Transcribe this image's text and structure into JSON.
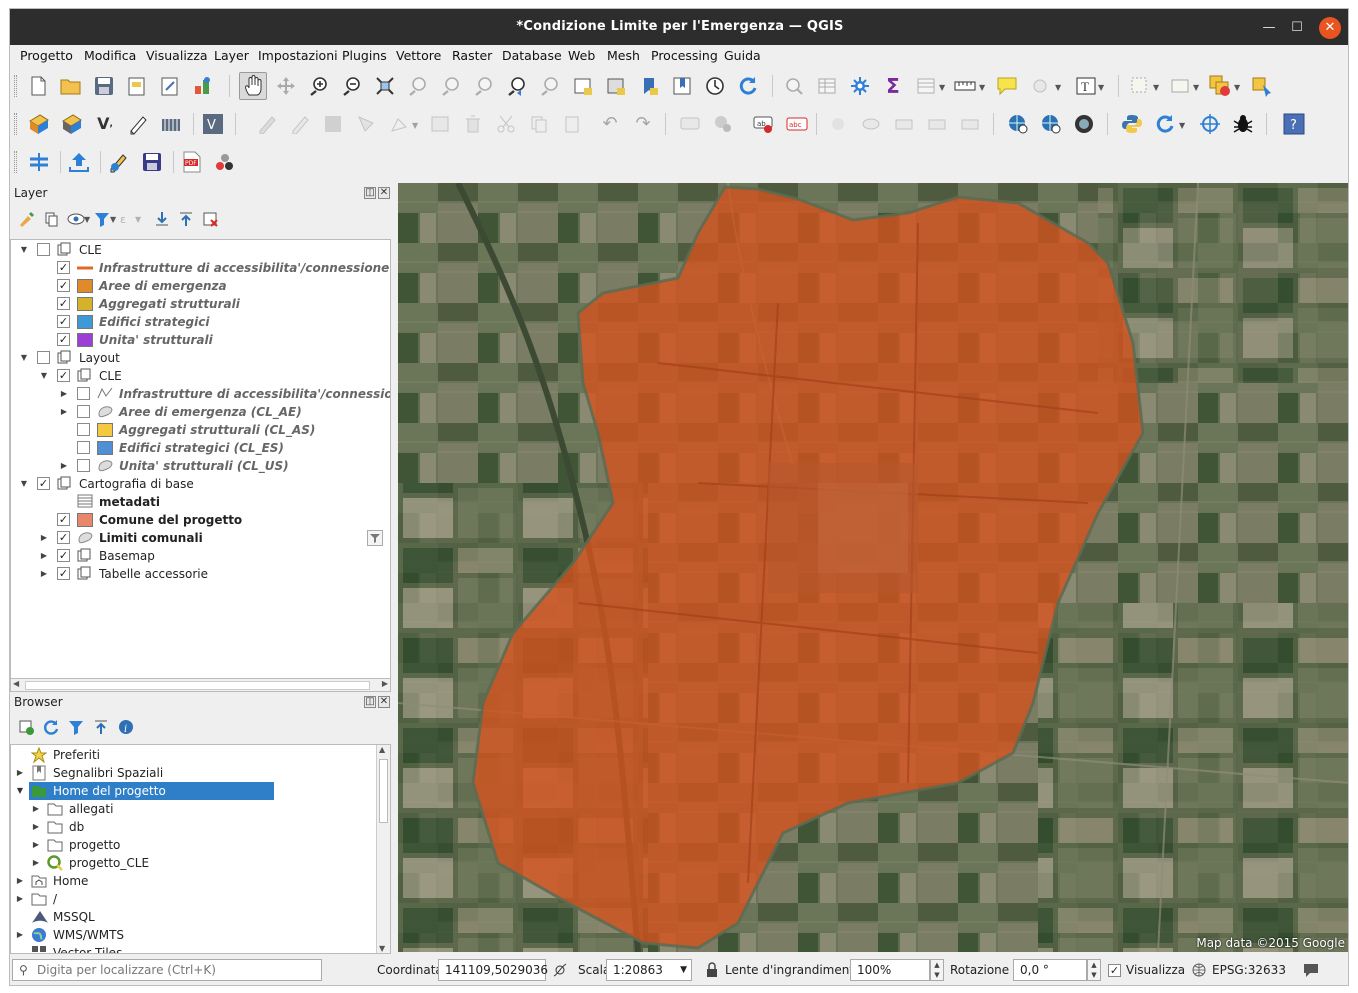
{
  "window": {
    "title": "*Condizione Limite per l'Emergenza — QGIS",
    "minimize": "—",
    "maximize": "☐",
    "close": "✕"
  },
  "menus": [
    "Progetto",
    "Modifica",
    "Visualizza",
    "Layer",
    "Impostazioni",
    "Plugins",
    "Vettore",
    "Raster",
    "Database",
    "Web",
    "Mesh",
    "Processing",
    "Guida"
  ],
  "layers_panel": {
    "title": "Layer",
    "items": [
      {
        "label": "CLE",
        "style": "normal",
        "checked": false,
        "indent": 0,
        "expand": "open",
        "icon": "group"
      },
      {
        "label": "Infrastrutture di accessibilita'/connessione",
        "style": "italic",
        "checked": true,
        "indent": 1,
        "symbol": "line",
        "color": "#e0692a"
      },
      {
        "label": "Aree di emergenza",
        "style": "italic",
        "checked": true,
        "indent": 1,
        "symbol": "fill",
        "color": "#e08a2a"
      },
      {
        "label": "Aggregati strutturali",
        "style": "italic",
        "checked": true,
        "indent": 1,
        "symbol": "fill",
        "color": "#d6b12a"
      },
      {
        "label": "Edifici strategici",
        "style": "italic",
        "checked": true,
        "indent": 1,
        "symbol": "fill",
        "color": "#3e9ad6"
      },
      {
        "label": "Unita' strutturali",
        "style": "italic",
        "checked": true,
        "indent": 1,
        "symbol": "fill",
        "color": "#9b3fd6"
      },
      {
        "label": "Layout",
        "style": "normal",
        "checked": false,
        "indent": 0,
        "expand": "open",
        "icon": "group"
      },
      {
        "label": "CLE",
        "style": "normal",
        "checked": true,
        "indent": 1,
        "expand": "open",
        "icon": "group"
      },
      {
        "label": "Infrastrutture di accessibilita'/connessione (CL-AC)",
        "style": "italic",
        "checked": false,
        "indent": 2,
        "expand": "closed",
        "symbol": "linegeom"
      },
      {
        "label": "Aree di emergenza (CL_AE)",
        "style": "italic",
        "checked": false,
        "indent": 2,
        "expand": "closed",
        "symbol": "polygeom"
      },
      {
        "label": "Aggregati strutturali (CL_AS)",
        "style": "italic",
        "checked": false,
        "indent": 2,
        "symbol": "fill",
        "color": "#f5c842"
      },
      {
        "label": "Edifici strategici (CL_ES)",
        "style": "italic",
        "checked": false,
        "indent": 2,
        "symbol": "fill",
        "color": "#4f8fd6"
      },
      {
        "label": "Unita' strutturali (CL_US)",
        "style": "italic",
        "checked": false,
        "indent": 2,
        "expand": "closed",
        "symbol": "polygeom"
      },
      {
        "label": "Cartografia di base",
        "style": "normal",
        "checked": true,
        "indent": 0,
        "expand": "open",
        "icon": "group"
      },
      {
        "label": "metadati",
        "style": "bold",
        "indent": 1,
        "symbol": "table"
      },
      {
        "label": "Comune del progetto",
        "style": "bold",
        "checked": true,
        "indent": 1,
        "symbol": "fill",
        "color": "#e8876a"
      },
      {
        "label": "Limiti comunali",
        "style": "bold",
        "checked": true,
        "indent": 1,
        "expand": "closed",
        "symbol": "polygeom",
        "filter": true
      },
      {
        "label": "Basemap",
        "style": "normal",
        "checked": true,
        "indent": 1,
        "expand": "closed",
        "icon": "group"
      },
      {
        "label": "Tabelle accessorie",
        "style": "normal",
        "checked": true,
        "indent": 1,
        "expand": "closed",
        "icon": "group"
      }
    ]
  },
  "browser_panel": {
    "title": "Browser",
    "items": [
      {
        "label": "Preferiti",
        "indent": 0,
        "icon": "star"
      },
      {
        "label": "Segnalibri Spaziali",
        "indent": 0,
        "expand": "closed",
        "icon": "bookmark"
      },
      {
        "label": "Home del progetto",
        "indent": 0,
        "expand": "open",
        "icon": "folder-home",
        "selected": true
      },
      {
        "label": "allegati",
        "indent": 1,
        "expand": "closed",
        "icon": "folder"
      },
      {
        "label": "db",
        "indent": 1,
        "expand": "closed",
        "icon": "folder"
      },
      {
        "label": "progetto",
        "indent": 1,
        "expand": "closed",
        "icon": "folder"
      },
      {
        "label": "progetto_CLE",
        "indent": 1,
        "expand": "closed",
        "icon": "qgis"
      },
      {
        "label": "Home",
        "indent": 0,
        "expand": "closed",
        "icon": "home"
      },
      {
        "label": "/",
        "indent": 0,
        "expand": "closed",
        "icon": "folder"
      },
      {
        "label": "MSSQL",
        "indent": 0,
        "icon": "mssql"
      },
      {
        "label": "WMS/WMTS",
        "indent": 0,
        "expand": "closed",
        "icon": "globe"
      },
      {
        "label": "Vector Tiles",
        "indent": 0,
        "icon": "tiles"
      }
    ]
  },
  "map": {
    "attribution": "Map data ©2015 Google",
    "polygon_color": "#d4521e"
  },
  "statusbar": {
    "search_placeholder": "Digita per localizzare (Ctrl+K)",
    "coord_label": "Coordinata",
    "coord_value": "141109,5029036",
    "scale_label": "Scala",
    "scale_value": "1:20863",
    "magnifier_label": "Lente d'ingrandimento",
    "magnifier_value": "100%",
    "rotation_label": "Rotazione",
    "rotation_value": "0,0 °",
    "render_label": "Visualizza",
    "crs": "EPSG:32633"
  }
}
